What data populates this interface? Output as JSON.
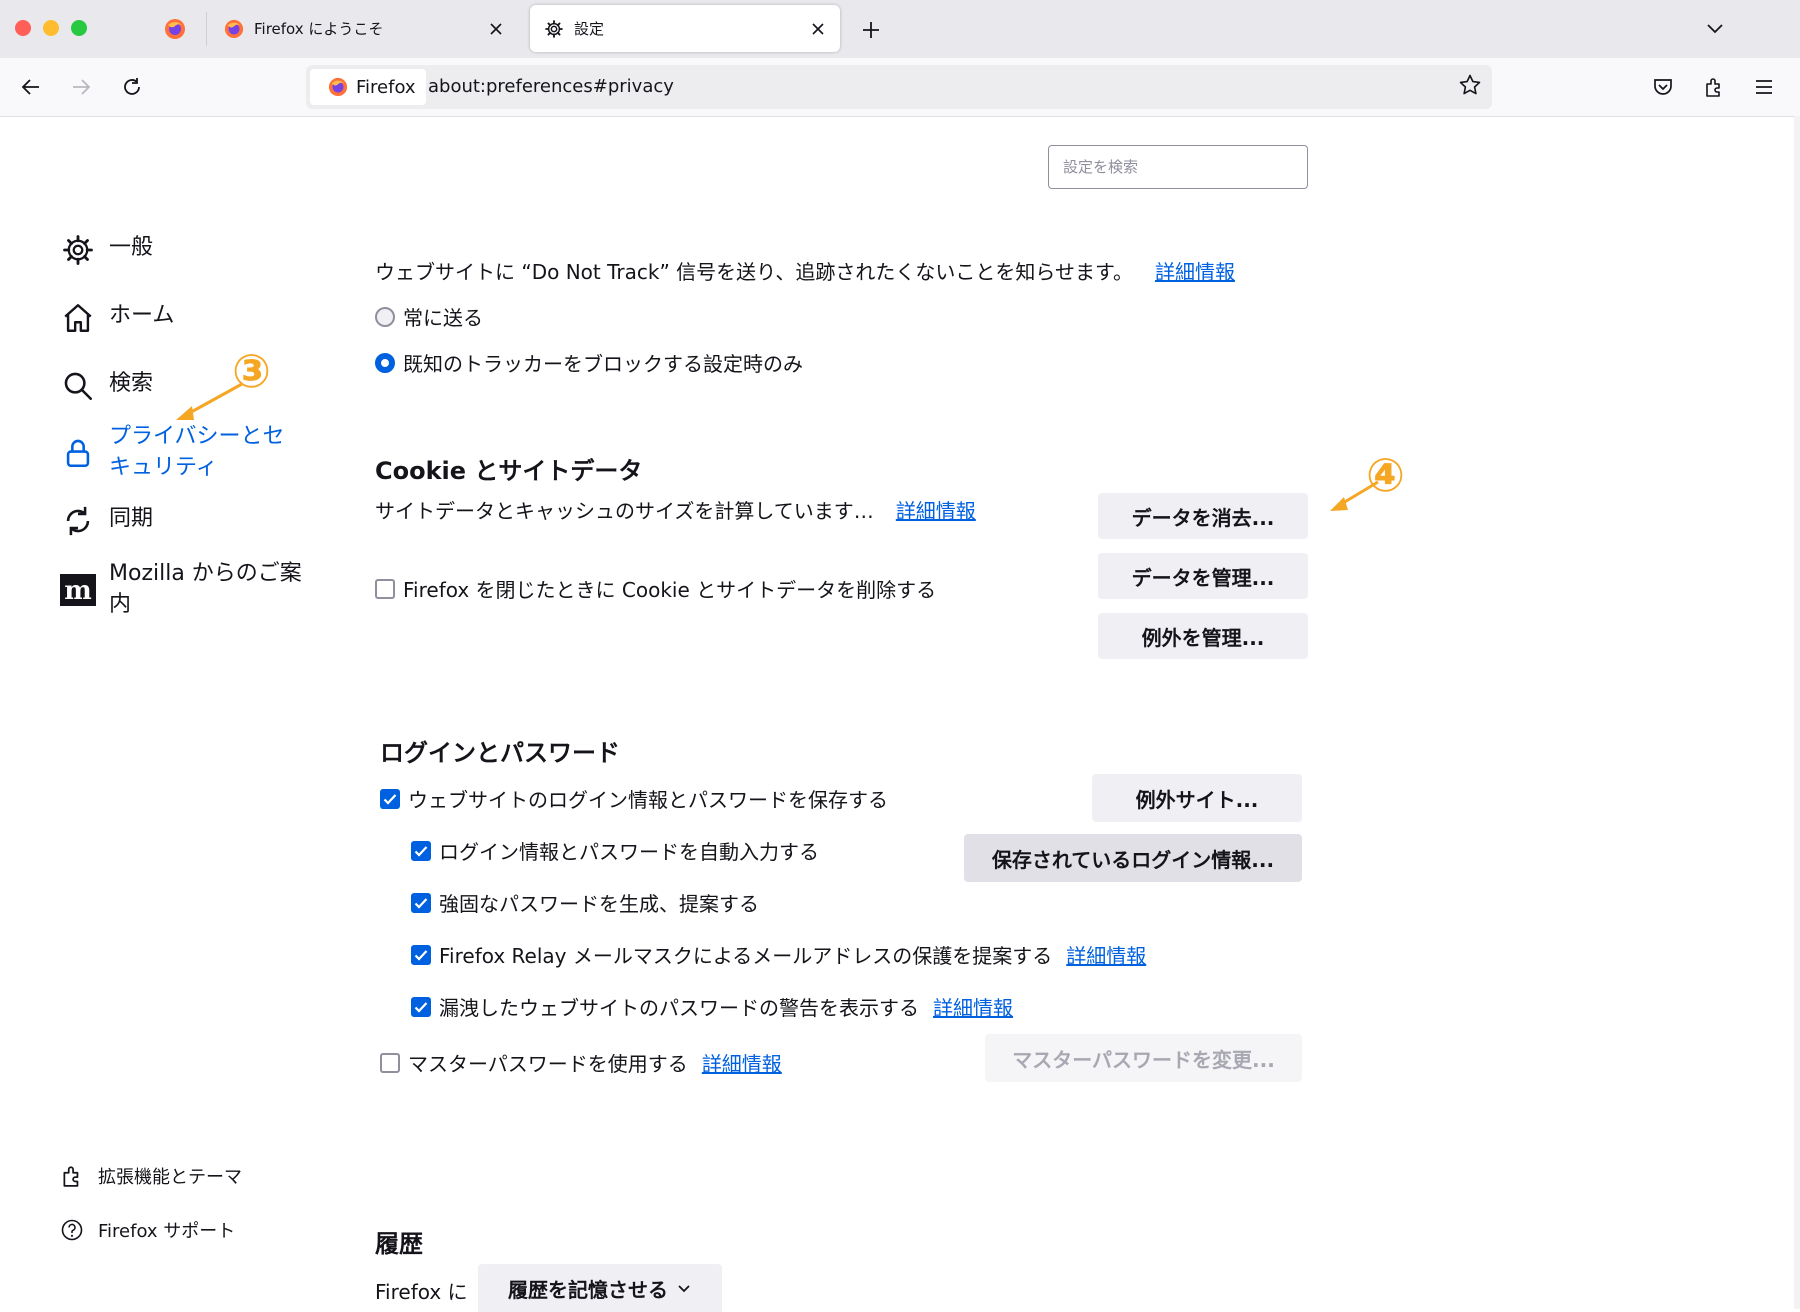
{
  "colors": {
    "accent": "#0061e0",
    "annotation": "#f5a623"
  },
  "tabs": [
    {
      "label": "Firefox にようこそ",
      "icon": "firefox-logo-icon"
    },
    {
      "label": "設定",
      "icon": "gear-icon",
      "active": true
    }
  ],
  "nav": {
    "identity_label": "Firefox",
    "url": "about:preferences#privacy"
  },
  "sidebar": {
    "items": [
      {
        "label": "一般",
        "icon": "gear-icon"
      },
      {
        "label": "ホーム",
        "icon": "home-icon"
      },
      {
        "label": "検索",
        "icon": "search-icon"
      },
      {
        "label": "プライバシーとセ\nキュリティ",
        "icon": "lock-icon",
        "selected": true
      },
      {
        "label": "同期",
        "icon": "sync-icon"
      },
      {
        "label": "Mozilla からのご案\n内",
        "icon": "mozilla-icon"
      }
    ],
    "footer": [
      {
        "label": "拡張機能とテーマ",
        "icon": "puzzle-icon"
      },
      {
        "label": "Firefox サポート",
        "icon": "help-icon"
      }
    ]
  },
  "search": {
    "placeholder": "設定を検索"
  },
  "dnt": {
    "description": "ウェブサイトに “Do Not Track” 信号を送り、追跡されたくないことを知らせます。",
    "learn_more": "詳細情報",
    "options": [
      {
        "label": "常に送る",
        "checked": false
      },
      {
        "label": "既知のトラッカーをブロックする設定時のみ",
        "checked": true
      }
    ]
  },
  "cookies": {
    "title": "Cookie とサイトデータ",
    "size_text": "サイトデータとキャッシュのサイズを計算しています…",
    "learn_more": "詳細情報",
    "delete_on_close": {
      "label": "Firefox を閉じたときに Cookie とサイトデータを削除する",
      "checked": false
    },
    "buttons": {
      "clear": "データを消去...",
      "manage": "データを管理...",
      "exceptions": "例外を管理..."
    }
  },
  "logins": {
    "title": "ログインとパスワード",
    "save_logins": {
      "label": "ウェブサイトのログイン情報とパスワードを保存する",
      "checked": true
    },
    "autofill": {
      "label": "ログイン情報とパスワードを自動入力する",
      "checked": true
    },
    "generate": {
      "label": "強固なパスワードを生成、提案する",
      "checked": true
    },
    "relay": {
      "label": "Firefox Relay メールマスクによるメールアドレスの保護を提案する",
      "checked": true,
      "learn_more": "詳細情報"
    },
    "breach": {
      "label": "漏洩したウェブサイトのパスワードの警告を表示する",
      "checked": true,
      "learn_more": "詳細情報"
    },
    "master": {
      "label": "マスターパスワードを使用する",
      "checked": false,
      "learn_more": "詳細情報"
    },
    "buttons": {
      "exceptions": "例外サイト...",
      "saved_logins": "保存されているログイン情報...",
      "change_master": "マスターパスワードを変更..."
    }
  },
  "history": {
    "title": "履歴",
    "prefix": "Firefox に",
    "select_value": "履歴を記憶させる"
  },
  "annotations": {
    "step3": "③",
    "step4": "④"
  }
}
